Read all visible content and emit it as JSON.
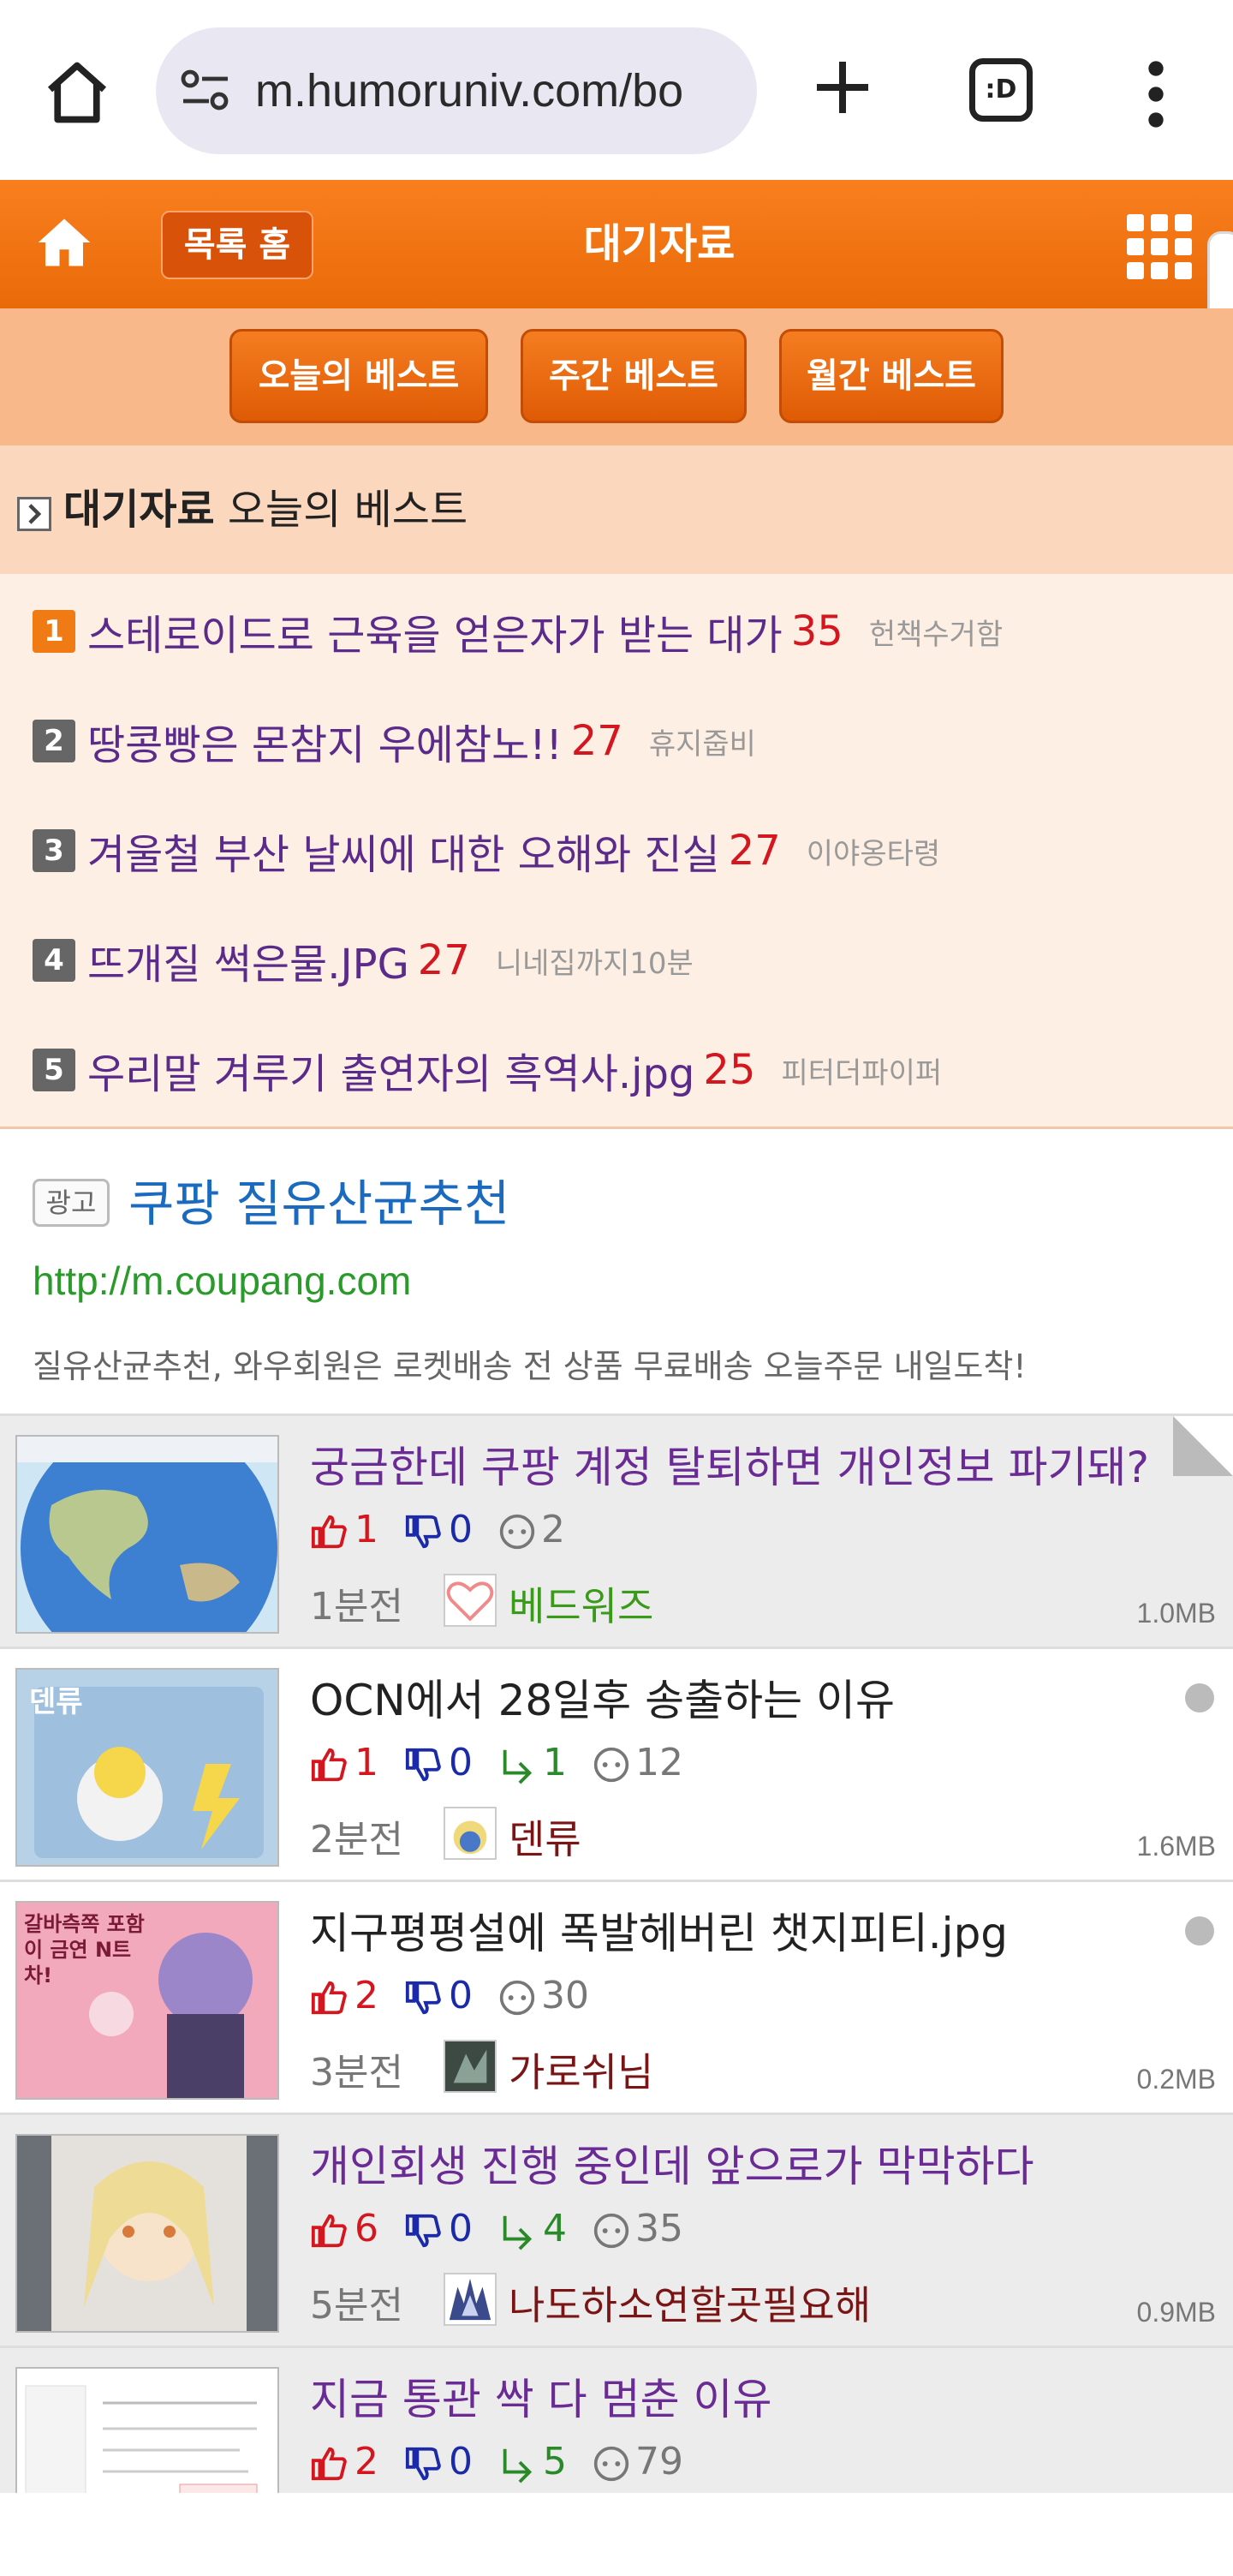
{
  "browser": {
    "url": "m.humoruniv.com/bo",
    "tabs_label": ":D"
  },
  "header": {
    "list_home": "목록 홈",
    "title": "대기자료"
  },
  "best_tabs": [
    "오늘의 베스트",
    "주간 베스트",
    "월간 베스트"
  ],
  "section": {
    "bold": "대기자료",
    "rest": " 오늘의 베스트"
  },
  "best_list": [
    {
      "rank": "1",
      "title": "스테로이드로 근육을 얻은자가 받는 대가",
      "count": "35",
      "author": "헌책수거함"
    },
    {
      "rank": "2",
      "title": "땅콩빵은 몬참지 우에참노!!",
      "count": "27",
      "author": "휴지줍비"
    },
    {
      "rank": "3",
      "title": "겨울철 부산 날씨에 대한 오해와 진실",
      "count": "27",
      "author": "이야옹타령"
    },
    {
      "rank": "4",
      "title": "뜨개질 썩은물.JPG",
      "count": "27",
      "author": "니네집까지10분"
    },
    {
      "rank": "5",
      "title": "우리말 겨루기 출연자의 흑역사.jpg",
      "count": "25",
      "author": "피터더파이퍼"
    }
  ],
  "ad": {
    "badge": "광고",
    "title": "쿠팡 질유산균추천",
    "url": "http://m.coupang.com",
    "desc": "질유산균추천, 와우회원은 로켓배송 전 상품 무료배송 오늘주문 내일도착!"
  },
  "posts": [
    {
      "title": "궁금한데 쿠팡 계정 탈퇴하면 개인정보 파기돼?",
      "up": "1",
      "down": "0",
      "reply": "",
      "comments": "2",
      "time": "1분전",
      "author": "베드워즈",
      "size": "1.0MB",
      "thumb_text": ""
    },
    {
      "title": "OCN에서 28일후 송출하는 이유",
      "up": "1",
      "down": "0",
      "reply": "1",
      "comments": "12",
      "time": "2분전",
      "author": "덴류",
      "size": "1.6MB",
      "thumb_text": "덴류"
    },
    {
      "title": "지구평평설에 폭발헤버린 챗지피티.jpg",
      "up": "2",
      "down": "0",
      "reply": "",
      "comments": "30",
      "time": "3분전",
      "author": "가로쉬님",
      "size": "0.2MB",
      "thumb_text": "갈바측쪽 포함이 금연 N트차!"
    },
    {
      "title": "개인회생 진행 중인데 앞으로가 막막하다",
      "up": "6",
      "down": "0",
      "reply": "4",
      "comments": "35",
      "time": "5분전",
      "author": "나도하소연할곳필요해",
      "size": "0.9MB",
      "thumb_text": ""
    },
    {
      "title": "지금 통관 싹 다 멈춘 이유",
      "up": "2",
      "down": "0",
      "reply": "5",
      "comments": "79",
      "time": "",
      "author": "",
      "size": "",
      "thumb_text": ""
    }
  ],
  "colors": {
    "header_orange": "#f26f0e",
    "strip_peach": "#f8b889",
    "visited_title": "#6a2b94",
    "up_red": "#d4161f",
    "down_blue": "#1a2aa8",
    "reply_green": "#2a8a2a"
  }
}
